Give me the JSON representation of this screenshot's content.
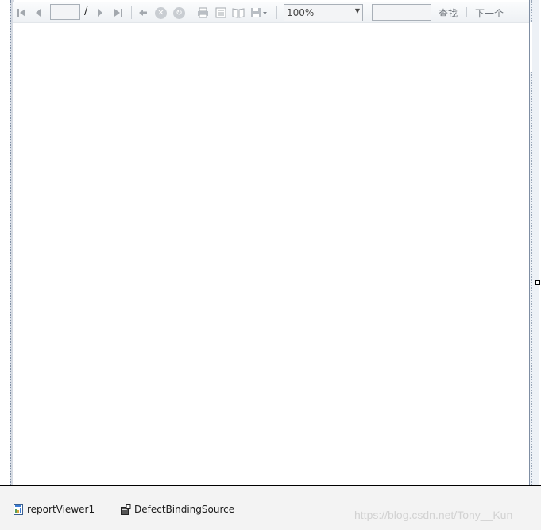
{
  "toolbar": {
    "icons": {
      "first_page": "first-page-icon",
      "previous_page": "previous-page-icon",
      "next_page": "next-page-icon",
      "last_page": "last-page-icon",
      "back": "back-icon",
      "stop": "stop-icon",
      "refresh": "refresh-icon",
      "print": "print-icon",
      "print_layout": "print-layout-icon",
      "page_setup": "page-setup-icon",
      "export": "export-icon"
    },
    "page_number_value": "",
    "page_separator": "/",
    "zoom": {
      "selected": "100%"
    },
    "find_value": "",
    "find_label": "查找",
    "next_label": "下一个"
  },
  "tray": {
    "items": [
      {
        "label": "reportViewer1",
        "icon": "report-viewer-icon"
      },
      {
        "label": "DefectBindingSource",
        "icon": "binding-source-icon"
      }
    ],
    "watermark": "https://blog.csdn.net/Tony__Kun"
  },
  "colors": {
    "frame": "#7f8ea3",
    "toolbar_bg": "#eef1f4",
    "tray_bg": "#f3f3f3",
    "disabled_icon": "#a3a8ae"
  }
}
